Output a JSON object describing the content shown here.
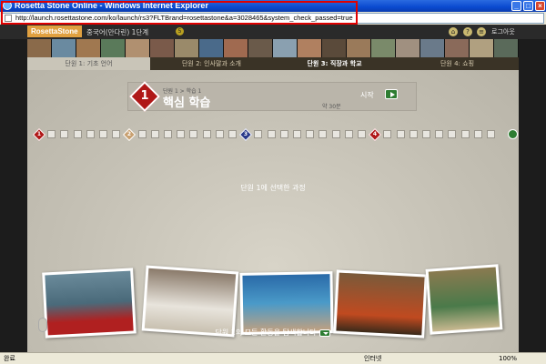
{
  "window": {
    "title": "Rosetta Stone Online - Windows Internet Explorer",
    "url": "http://launch.rosettastone.com/ko/launch/rs3?FLTBrand=rosettastone&a=3028465&system_check_passed=true"
  },
  "app": {
    "logo": "RosettaStone",
    "course_title": "중국어(만다린) 1단계",
    "logout": "로그아웃",
    "tabs": [
      {
        "label": "단원 1: 기초 언어"
      },
      {
        "label": "단원 2: 인사말과 소개"
      },
      {
        "label": "단원 3: 직장과 학교"
      },
      {
        "label": "단원 4: 쇼핑"
      }
    ],
    "lesson": {
      "number": "1",
      "breadcrumb": "단원 1 > 학습 1",
      "title": "핵심 학습",
      "duration": "약 30분",
      "start_label": "시작"
    },
    "progress_markers": [
      "1",
      "2",
      "3",
      "4"
    ],
    "unit_selected": "단원 1에 선택한 과정",
    "explore_label": "단원 1의 모든 활동을 탐색합니다",
    "colors": {
      "accent_red": "#b01818",
      "accent_green": "#2e7d32",
      "logo": "#e0a040"
    }
  },
  "status": {
    "left": "완료",
    "zone": "인터넷",
    "zoom": "100%"
  }
}
